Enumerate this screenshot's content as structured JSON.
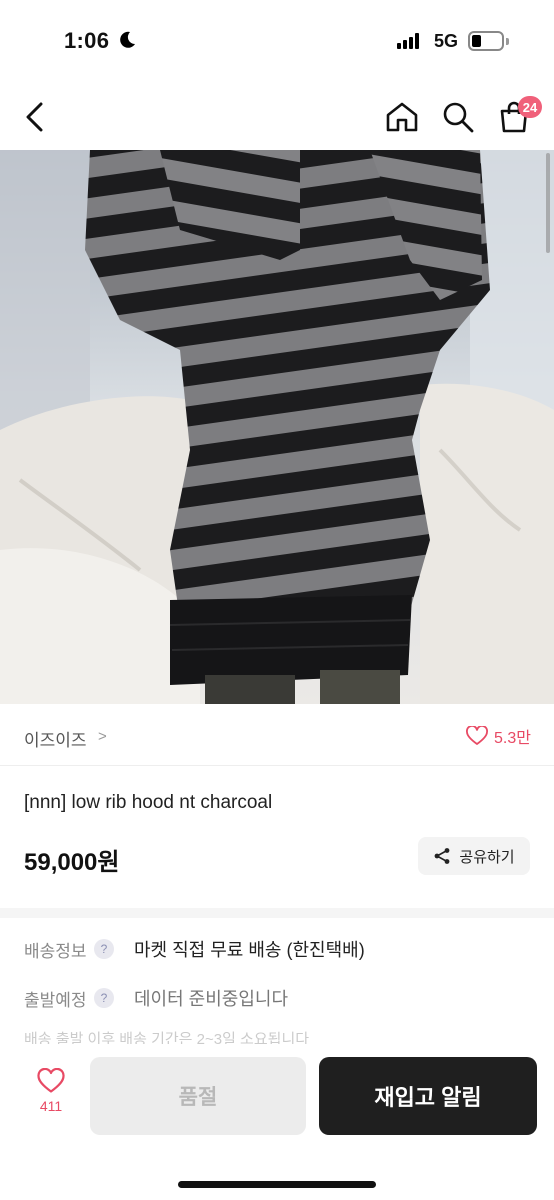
{
  "status_bar": {
    "time": "1:06",
    "network": "5G"
  },
  "nav": {
    "cart_count": "24"
  },
  "shop": {
    "name": "이즈이즈",
    "chevron": ">",
    "like_count": "5.3만"
  },
  "product": {
    "name": "[nnn] low rib hood nt charcoal",
    "price": "59,000원",
    "share_label": "공유하기"
  },
  "info": [
    {
      "label": "배송정보",
      "value": "마켓 직접 무료 배송 (한진택배)"
    },
    {
      "label": "출발예정",
      "value": "데이터 준비중입니다"
    }
  ],
  "faded_text": "배송 출발 이후 배송 기간은 2~3일 소요됩니다",
  "bottom": {
    "wish_count": "411",
    "soldout_label": "품절",
    "restock_label": "재입고 알림"
  },
  "colors": {
    "accent_pink": "#e84a64",
    "badge_pink": "#f0607a",
    "primary_dark": "#1f1f1f"
  }
}
